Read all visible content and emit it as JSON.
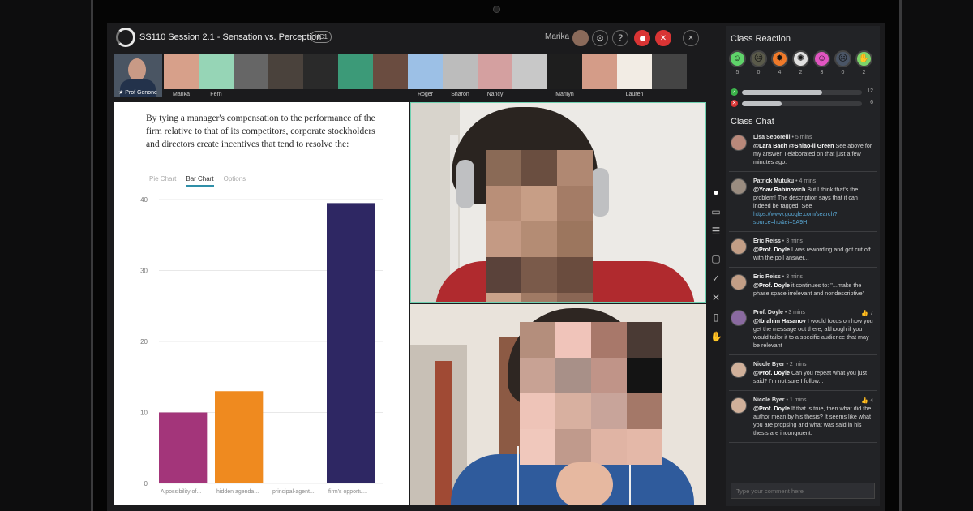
{
  "session": {
    "title": "SS110 Session 2.1 - Sensation vs. Perception",
    "badge": "HC1",
    "user": "Marika",
    "help_label": "?",
    "settings_icon": "gear-icon",
    "close_label": "×"
  },
  "participants": {
    "professor_label": "★ Prof Genone",
    "tiles": [
      {
        "label": "Marika",
        "color": "#d7a08a"
      },
      {
        "label": "Fern",
        "color": "#96d5b6"
      },
      {
        "label": "",
        "color": "#666666"
      },
      {
        "label": "",
        "color": "#4a423c"
      },
      {
        "label": "",
        "color": "#2a2a2a"
      },
      {
        "label": "",
        "color": "#3c9a78"
      },
      {
        "label": "",
        "color": "#6a4c40"
      },
      {
        "label": "Roger",
        "color": "#9cc0e6"
      },
      {
        "label": "Sharon",
        "color": "#bcbcbc"
      },
      {
        "label": "Nancy",
        "color": "#d4a0a0"
      },
      {
        "label": "",
        "color": "#c8c8c8"
      },
      {
        "label": "Marilyn",
        "color": "#1e1e1e"
      },
      {
        "label": "",
        "color": "#d49c88"
      },
      {
        "label": "Lauren",
        "color": "#f2ece4"
      },
      {
        "label": "",
        "color": "#444444"
      }
    ]
  },
  "poll": {
    "question": "By tying a manager's compensation to the performance of the firm relative to that of its competitors, corporate stockholders and directors create incentives that tend to resolve the:",
    "tabs": [
      "Pie Chart",
      "Bar Chart",
      "Options"
    ],
    "active_tab": 1
  },
  "chart_data": {
    "type": "bar",
    "categories": [
      "A possibility of...",
      "hidden agenda...",
      "principal-agent...",
      "firm's opportu..."
    ],
    "values": [
      10,
      13,
      0,
      39.5
    ],
    "colors": [
      "#a3357a",
      "#ef8a1f",
      "#8a8a8a",
      "#2e2763"
    ],
    "ylim": [
      0,
      40
    ],
    "yticks": [
      0,
      10,
      20,
      30,
      40
    ],
    "title": "",
    "xlabel": "",
    "ylabel": "",
    "grid": true
  },
  "reactions": {
    "title": "Class Reaction",
    "items": [
      {
        "icon": "smile-icon",
        "glyph": "☺",
        "count": "5",
        "color": "#5fd36a"
      },
      {
        "icon": "neutral-face-icon",
        "glyph": "☹",
        "count": "0",
        "color": "#5a5a4a"
      },
      {
        "icon": "fire-icon",
        "glyph": "✹",
        "count": "4",
        "color": "#f07a2a"
      },
      {
        "icon": "mind-blown-icon",
        "glyph": "✺",
        "count": "2",
        "color": "#e0e0e0"
      },
      {
        "icon": "laugh-icon",
        "glyph": "☺",
        "count": "3",
        "color": "#e255c2"
      },
      {
        "icon": "confused-icon",
        "glyph": "☹",
        "count": "0",
        "color": "#4a5566"
      },
      {
        "icon": "hand-raise-icon",
        "glyph": "✋",
        "count": "2",
        "color": "#7ed46a"
      }
    ],
    "agree": {
      "count": "12",
      "fill": 0.67
    },
    "disagree": {
      "count": "6",
      "fill": 0.33
    }
  },
  "chat": {
    "title": "Class Chat",
    "input_placeholder": "Type your comment here",
    "messages": [
      {
        "author": "Lisa Seporelli",
        "time": "5 mins",
        "mention": "@Lara Bach @Shiao-li Green",
        "text": " See above for my answer. I elaborated on that just a few minutes ago.",
        "link": "",
        "likes": "",
        "avatar": "#b8887a"
      },
      {
        "author": "Patrick Mutuku",
        "time": "4 mins",
        "mention": "@Yoav Rabinovich",
        "text": " But I think that's the problem! The description says that it can indeed be tagged. See",
        "link": "https://www.google.com/search?source=hp&ei=5A9H",
        "likes": "",
        "avatar": "#9a8c80"
      },
      {
        "author": "Eric Reiss",
        "time": "3 mins",
        "mention": "@Prof. Doyle",
        "text": " I was rewording and got cut off with the poll answer...",
        "link": "",
        "likes": "",
        "avatar": "#c29e86"
      },
      {
        "author": "Eric Reiss",
        "time": "3 mins",
        "mention": "@Prof. Doyle",
        "text": " it continues to: \"...make the phase space irrelevant and nondescriptive\"",
        "link": "",
        "likes": "",
        "avatar": "#c29e86"
      },
      {
        "author": "Prof. Doyle",
        "time": "3 mins",
        "mention": "@Ibrahim Hasanov",
        "text": " I would focus on how you get the message out there, although if you would tailor it to a specific audience that may be relevant",
        "link": "",
        "likes": "7",
        "avatar": "#8a6aa0"
      },
      {
        "author": "Nicole Byer",
        "time": "2 mins",
        "mention": "@Prof. Doyle",
        "text": " Can you repeat what you just said? I'm not sure I follow...",
        "link": "",
        "likes": "",
        "avatar": "#d0b09a"
      },
      {
        "author": "Nicole Byer",
        "time": "1 mins",
        "mention": "@Prof. Doyle",
        "text": " If that is true, then what did the author mean by his thesis? It seems like what you are propsing and what was said in his thesis are incongruent.",
        "link": "",
        "likes": "4",
        "avatar": "#d0b09a"
      }
    ]
  }
}
